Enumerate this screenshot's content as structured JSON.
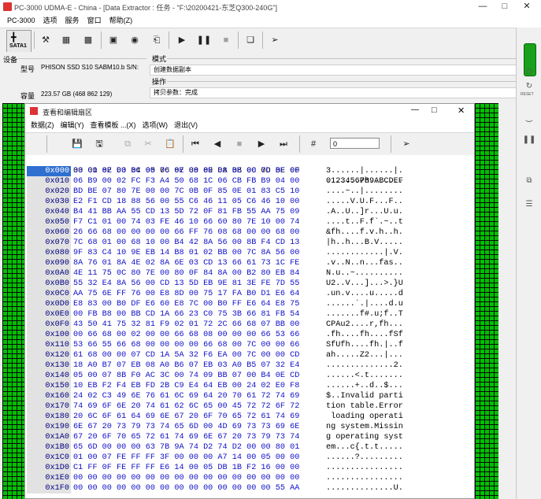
{
  "main_window": {
    "title": "PC-3000 UDMA-E - China - [Data Extractor : 任务 - \"F:\\20200421-东芝Q300-240G\"]",
    "menu": [
      "PC-3000",
      "选项",
      "服务",
      "窗口",
      "帮助(Z)"
    ]
  },
  "toolbar": {
    "sata_label": "SATA1",
    "icons": [
      "sata-port-icon",
      "tools-icon",
      "utility-icon",
      "chip-icon",
      "device-icon",
      "search-binoculars-icon",
      "export-icon",
      "play-icon",
      "pause-icon",
      "stop-icon",
      "log-window-icon",
      "exit-icon"
    ]
  },
  "info": {
    "device_group": "设备",
    "model_label": "型号",
    "model_value": "PHISON SSD S10 SABM10.b S/N:",
    "capacity_label": "容量",
    "capacity_value": "223.57 GB (468 862 129)",
    "mode_group": "模式",
    "mode_value": "创建数据副本",
    "operation_group": "操作",
    "operation_value": "拷贝参数：完成"
  },
  "right_toolbar": {
    "icons": [
      "drive-status-icon",
      "power-icon",
      "reset-icon",
      "power-cycle-icon",
      "pause-side-icon",
      "copy-side-icon",
      "settings-side-icon"
    ],
    "reset_label": "RESET"
  },
  "hex_window": {
    "title": "查看和编辑扇区",
    "menu": [
      "数据(Z)",
      "编辑(Y)",
      "查看模板 ...(X)",
      "选项(W)",
      "退出(V)"
    ],
    "offset_value": "0",
    "header_cols": "00 01 02 03 04 05 06 07 08 09 0A 0B 0C 0D 0E 0F",
    "header_ascii": "0123456789ABCDEF",
    "rows": [
      {
        "addr": "0x000",
        "hex": "33 C0 8E D0 BC 00 7C 8E C0 8E D8 BE 00 7C BF 00",
        "ascii": "3......|......|."
      },
      {
        "addr": "0x010",
        "hex": "06 B9 00 02 FC F3 A4 50 68 1C 06 CB FB B9 04 00",
        "ascii": ".......Ph......."
      },
      {
        "addr": "0x020",
        "hex": "BD BE 07 80 7E 00 00 7C 0B 0F 85 0E 01 83 C5 10",
        "ascii": "....~..|........"
      },
      {
        "addr": "0x030",
        "hex": "E2 F1 CD 18 88 56 00 55 C6 46 11 05 C6 46 10 00",
        "ascii": ".....V.U.F...F.."
      },
      {
        "addr": "0x040",
        "hex": "B4 41 BB AA 55 CD 13 5D 72 0F 81 FB 55 AA 75 09",
        "ascii": ".A..U..]r...U.u."
      },
      {
        "addr": "0x050",
        "hex": "F7 C1 01 00 74 03 FE 46 10 66 60 80 7E 10 00 74",
        "ascii": "....t..F.f`.~..t"
      },
      {
        "addr": "0x060",
        "hex": "26 66 68 00 00 00 00 66 FF 76 08 68 00 00 68 00",
        "ascii": "&fh....f.v.h..h."
      },
      {
        "addr": "0x070",
        "hex": "7C 68 01 00 68 10 00 B4 42 8A 56 00 8B F4 CD 13",
        "ascii": "|h..h...B.V....."
      },
      {
        "addr": "0x080",
        "hex": "9F 83 C4 10 9E EB 14 B8 01 02 BB 00 7C 8A 56 00",
        "ascii": "............|.V."
      },
      {
        "addr": "0x090",
        "hex": "8A 76 01 8A 4E 02 8A 6E 03 CD 13 66 61 73 1C FE",
        "ascii": ".v..N..n...fas.."
      },
      {
        "addr": "0x0A0",
        "hex": "4E 11 75 0C 80 7E 00 80 0F 84 8A 00 B2 80 EB 84",
        "ascii": "N.u..~.........."
      },
      {
        "addr": "0x0B0",
        "hex": "55 32 E4 8A 56 00 CD 13 5D EB 9E 81 3E FE 7D 55",
        "ascii": "U2..V...]...>.}U"
      },
      {
        "addr": "0x0C0",
        "hex": "AA 75 6E FF 76 00 E8 8D 00 75 17 FA B0 D1 E6 64",
        "ascii": ".un.v....u.....d"
      },
      {
        "addr": "0x0D0",
        "hex": "E8 83 00 B0 DF E6 60 E8 7C 00 B0 FF E6 64 E8 75",
        "ascii": "......`.|....d.u"
      },
      {
        "addr": "0x0E0",
        "hex": "00 FB B8 00 BB CD 1A 66 23 C0 75 3B 66 81 FB 54",
        "ascii": ".......f#.u;f..T"
      },
      {
        "addr": "0x0F0",
        "hex": "43 50 41 75 32 81 F9 02 01 72 2C 66 68 07 BB 00",
        "ascii": "CPAu2....r,fh..."
      },
      {
        "addr": "0x100",
        "hex": "00 66 68 00 02 00 00 66 68 08 00 00 00 66 53 66",
        "ascii": ".fh....fh....fSf"
      },
      {
        "addr": "0x110",
        "hex": "53 66 55 66 68 00 00 00 00 66 68 00 7C 00 00 66",
        "ascii": "SfUfh....fh.|..f"
      },
      {
        "addr": "0x120",
        "hex": "61 68 00 00 07 CD 1A 5A 32 F6 EA 00 7C 00 00 CD",
        "ascii": "ah.....Z2...|..."
      },
      {
        "addr": "0x130",
        "hex": "18 A0 B7 07 EB 08 A0 B6 07 EB 03 A0 B5 07 32 E4",
        "ascii": "..............2."
      },
      {
        "addr": "0x140",
        "hex": "05 00 07 8B F0 AC 3C 00 74 09 BB 07 00 B4 0E CD",
        "ascii": "......<.t......."
      },
      {
        "addr": "0x150",
        "hex": "10 EB F2 F4 EB FD 2B C9 E4 64 EB 00 24 02 E0 F8",
        "ascii": "......+..d..$..."
      },
      {
        "addr": "0x160",
        "hex": "24 02 C3 49 6E 76 61 6C 69 64 20 70 61 72 74 69",
        "ascii": "$..Invalid parti"
      },
      {
        "addr": "0x170",
        "hex": "74 69 6F 6E 20 74 61 62 6C 65 00 45 72 72 6F 72",
        "ascii": "tion table.Error"
      },
      {
        "addr": "0x180",
        "hex": "20 6C 6F 61 64 69 6E 67 20 6F 70 65 72 61 74 69",
        "ascii": " loading operati"
      },
      {
        "addr": "0x190",
        "hex": "6E 67 20 73 79 73 74 65 6D 00 4D 69 73 73 69 6E",
        "ascii": "ng system.Missin"
      },
      {
        "addr": "0x1A0",
        "hex": "67 20 6F 70 65 72 61 74 69 6E 67 20 73 79 73 74",
        "ascii": "g operating syst"
      },
      {
        "addr": "0x1B0",
        "hex": "65 6D 00 00 00 63 7B 9A 74 D2 74 D2 00 00 80 01",
        "ascii": "em...c{.t.t....."
      },
      {
        "addr": "0x1C0",
        "hex": "01 00 07 FE FF FF 3F 00 00 00 A7 14 00 05 00 00",
        "ascii": "......?........."
      },
      {
        "addr": "0x1D0",
        "hex": "C1 FF 0F FE FF FF E6 14 00 05 DB 1B F2 16 00 00",
        "ascii": "................"
      },
      {
        "addr": "0x1E0",
        "hex": "00 00 00 00 00 00 00 00 00 00 00 00 00 00 00 00",
        "ascii": "................"
      },
      {
        "addr": "0x1F0",
        "hex": "00 00 00 00 00 00 00 00 00 00 00 00 00 00 55 AA",
        "ascii": "..............U."
      }
    ]
  },
  "colors": {
    "green_band": "#00c000",
    "hex_text": "#1010c8",
    "selection": "#2f6fd0"
  }
}
